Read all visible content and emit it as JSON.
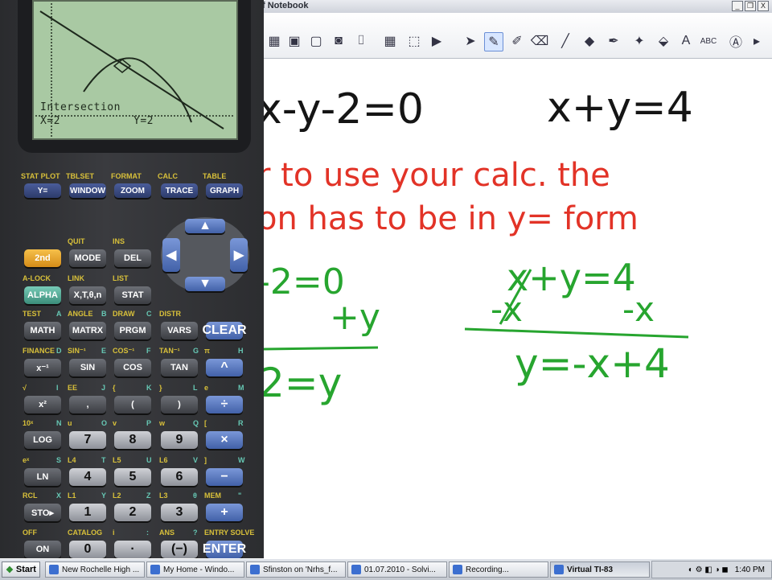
{
  "notebook": {
    "title": "f Notebook",
    "window_controls": [
      "_",
      "❐",
      "X"
    ],
    "toolbar_icons": [
      {
        "name": "gallery-icon",
        "glyph": "▦"
      },
      {
        "name": "attachment-icon",
        "glyph": "▣"
      },
      {
        "name": "screen-shade-icon",
        "glyph": "▢"
      },
      {
        "name": "camera-icon",
        "glyph": "◙"
      },
      {
        "name": "document-camera-icon",
        "glyph": "⌷"
      },
      {
        "name": "table-icon",
        "glyph": "▦"
      },
      {
        "name": "insert-icon",
        "glyph": "⬚"
      },
      {
        "name": "recorder-icon",
        "glyph": "▶"
      },
      {
        "name": "select-arrow-icon",
        "glyph": "➤"
      },
      {
        "name": "pen-icon",
        "glyph": "✎"
      },
      {
        "name": "creative-pen-icon",
        "glyph": "✐"
      },
      {
        "name": "eraser-icon",
        "glyph": "⌫"
      },
      {
        "name": "line-icon",
        "glyph": "╱"
      },
      {
        "name": "shapes-icon",
        "glyph": "◆"
      },
      {
        "name": "magic-pen-icon",
        "glyph": "✒"
      },
      {
        "name": "magic-wand-icon",
        "glyph": "✦"
      },
      {
        "name": "fill-icon",
        "glyph": "⬙"
      },
      {
        "name": "text-icon",
        "glyph": "A"
      },
      {
        "name": "handwriting-icon",
        "glyph": "ABC"
      },
      {
        "name": "properties-icon",
        "glyph": "Ⓐ"
      }
    ],
    "handwriting": {
      "black": [
        "x-y-2=0",
        "x+y=4"
      ],
      "red": [
        "r to use your calc. the",
        "on has to be in y= form"
      ],
      "green": [
        "-2=0",
        "+y",
        "2=y",
        "x+y=4",
        "-x",
        "-x",
        "y=-x+4"
      ]
    },
    "colors": {
      "black": "#151515",
      "red": "#e23327",
      "green": "#27a52f"
    }
  },
  "calculator": {
    "screen_text": {
      "line1": "Intersection",
      "x": "X=2",
      "y": "Y=2"
    },
    "top_labels": [
      "STAT PLOT",
      "TBLSET",
      "FORMAT",
      "CALC",
      "TABLE"
    ],
    "top_keys": [
      "Y=",
      "WINDOW",
      "ZOOM",
      "TRACE",
      "GRAPH"
    ],
    "rows": [
      {
        "labels": [
          [
            "",
            ""
          ],
          [
            "QUIT",
            ""
          ],
          [
            "INS",
            ""
          ]
        ],
        "keys": [
          "2nd",
          "MODE",
          "DEL"
        ]
      },
      {
        "labels": [
          [
            "A-LOCK",
            ""
          ],
          [
            "LINK",
            ""
          ],
          [
            "LIST",
            ""
          ]
        ],
        "keys": [
          "ALPHA",
          "X,T,θ,n",
          "STAT"
        ]
      },
      {
        "labels": [
          [
            "TEST",
            "A"
          ],
          [
            "ANGLE",
            "B"
          ],
          [
            "DRAW",
            "C"
          ],
          [
            "DISTR",
            ""
          ]
        ],
        "keys": [
          "MATH",
          "MATRX",
          "PRGM",
          "VARS",
          "CLEAR"
        ]
      },
      {
        "labels": [
          [
            "FINANCE",
            "D"
          ],
          [
            "SIN⁻¹",
            "E"
          ],
          [
            "COS⁻¹",
            "F"
          ],
          [
            "TAN⁻¹",
            "G"
          ],
          [
            "π",
            "H"
          ]
        ],
        "keys": [
          "x⁻¹",
          "SIN",
          "COS",
          "TAN",
          "^"
        ]
      },
      {
        "labels": [
          [
            "√",
            "I"
          ],
          [
            "EE",
            "J"
          ],
          [
            "{",
            "K"
          ],
          [
            "}",
            "L"
          ],
          [
            "e",
            "M"
          ]
        ],
        "keys": [
          "x²",
          ",",
          "(",
          ")",
          "÷"
        ]
      },
      {
        "labels": [
          [
            "10ˣ",
            "N"
          ],
          [
            "u",
            "O"
          ],
          [
            "v",
            "P"
          ],
          [
            "w",
            "Q"
          ],
          [
            "[",
            "R"
          ]
        ],
        "keys": [
          "LOG",
          "7",
          "8",
          "9",
          "×"
        ]
      },
      {
        "labels": [
          [
            "eˣ",
            "S"
          ],
          [
            "L4",
            "T"
          ],
          [
            "L5",
            "U"
          ],
          [
            "L6",
            "V"
          ],
          [
            "]",
            "W"
          ]
        ],
        "keys": [
          "LN",
          "4",
          "5",
          "6",
          "−"
        ]
      },
      {
        "labels": [
          [
            "RCL",
            "X"
          ],
          [
            "L1",
            "Y"
          ],
          [
            "L2",
            "Z"
          ],
          [
            "L3",
            "θ"
          ],
          [
            "MEM",
            "\""
          ]
        ],
        "keys": [
          "STO▸",
          "1",
          "2",
          "3",
          "+"
        ]
      },
      {
        "labels": [
          [
            "OFF",
            ""
          ],
          [
            "CATALOG",
            ""
          ],
          [
            "i",
            ":"
          ],
          [
            "ANS",
            "?"
          ],
          [
            "ENTRY SOLVE",
            ""
          ]
        ],
        "keys": [
          "ON",
          "0",
          "·",
          "(−)",
          "ENTER"
        ]
      }
    ]
  },
  "taskbar": {
    "start": "Start",
    "items": [
      "New Rochelle High ...",
      "My Home - Windo...",
      "Sfinston on 'Nrhs_f...",
      "01.07.2010 - Solvi...",
      "Recording...",
      "Virtual TI-83"
    ],
    "active_index": 5,
    "clock": "1:40 PM"
  }
}
